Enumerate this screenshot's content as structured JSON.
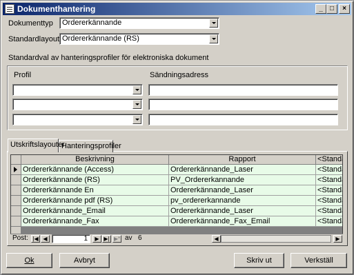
{
  "window": {
    "title": "Dokumenthantering"
  },
  "form": {
    "dokumenttyp_label": "Dokumenttyp",
    "dokumenttyp_value": "Ordererkännande",
    "standardlayout_label": "Standardlayout",
    "standardlayout_value": "Ordererkännande (RS)",
    "section_label": "Standardval av hanteringsprofiler för elektroniska dokument",
    "profil_label": "Profil",
    "sandningsadress_label": "Sändningsadress"
  },
  "tabs": [
    {
      "label": "Utskriftslayouter",
      "active": true
    },
    {
      "label": "Hanteringsprofiler",
      "active": false
    }
  ],
  "grid": {
    "columns": [
      "Beskrivning",
      "Rapport",
      "<Standa"
    ],
    "rows": [
      [
        "Ordererkännande (Access)",
        "Ordererkännande_Laser",
        "<Standa"
      ],
      [
        "Ordererkännande (RS)",
        "PV_Ordererkannande",
        "<Standa"
      ],
      [
        "Ordererkännande En",
        "Ordererkännande_Laser",
        "<Standa"
      ],
      [
        "Ordererkännande pdf (RS)",
        "pv_ordererkannande",
        "<Standa"
      ],
      [
        "Ordererkännande_Email",
        "Ordererkännande_Laser",
        "<Standa"
      ],
      [
        "Ordererkännande_Fax",
        "Ordererkännande_Fax_Email",
        "<Standa"
      ]
    ]
  },
  "navigator": {
    "label": "Post:",
    "current": "1",
    "of_label": "av",
    "total": "6"
  },
  "buttons": {
    "ok": "Ok",
    "avbryt": "Avbryt",
    "skriv_ut": "Skriv ut",
    "verkstall": "Verkställ"
  }
}
